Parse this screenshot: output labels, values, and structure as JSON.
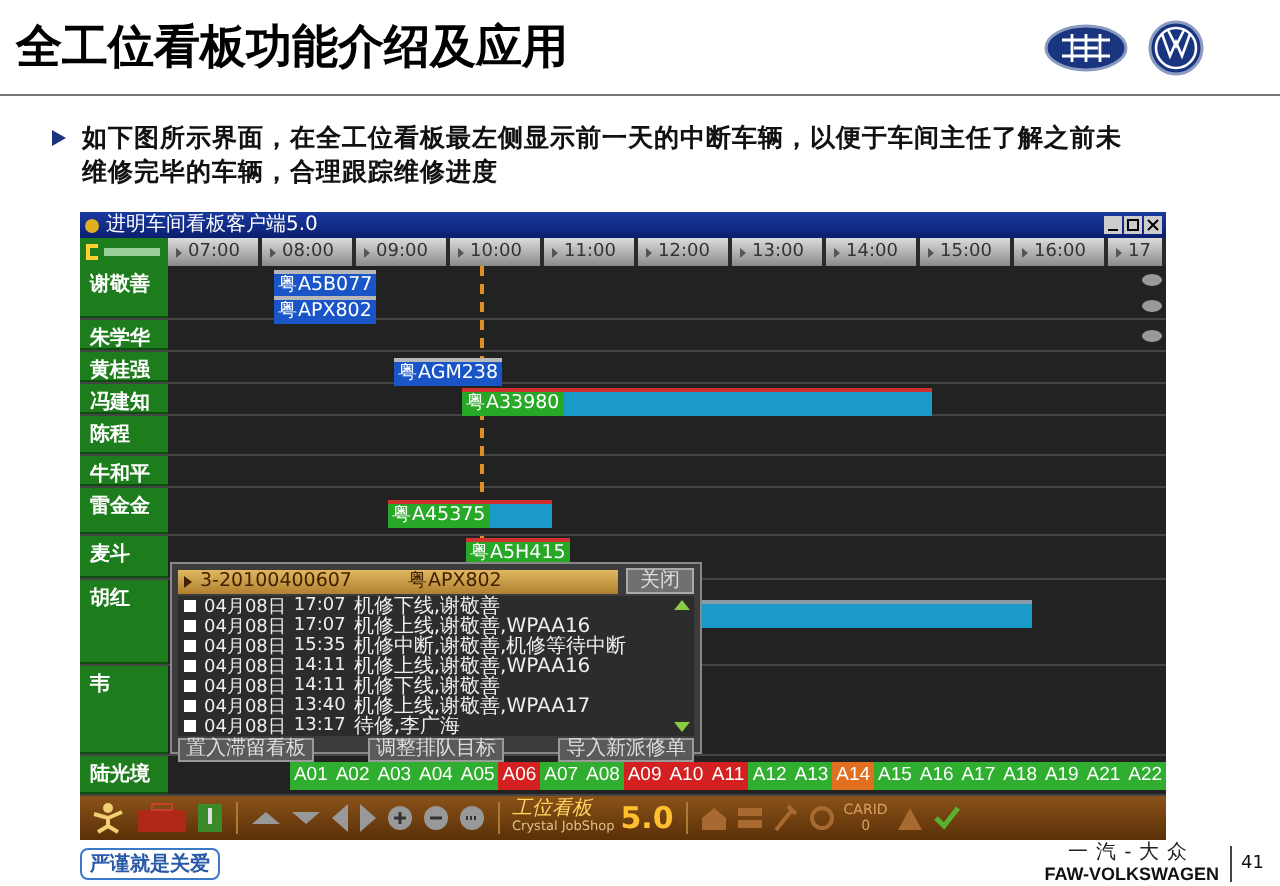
{
  "slide": {
    "title": "全工位看板功能介绍及应用",
    "bullet": "如下图所示界面，在全工位看板最左侧显示前一天的中断车辆，以便于车间主任了解之前未维修完毕的车辆，合理跟踪维修进度"
  },
  "app": {
    "title": "进明车间看板客户端5.0",
    "hours": [
      "07:00",
      "08:00",
      "09:00",
      "10:00",
      "11:00",
      "12:00",
      "13:00",
      "14:00",
      "15:00",
      "16:00",
      "17"
    ],
    "technicians": [
      {
        "name": "谢敬善",
        "bars": [
          {
            "plate": "粤A5B077",
            "kind": "queued"
          },
          {
            "plate": "粤APX802",
            "kind": "queued"
          }
        ]
      },
      {
        "name": "朱学华"
      },
      {
        "name": "黄桂强",
        "bars": [
          {
            "plate": "粤AGM238",
            "kind": "queued"
          }
        ]
      },
      {
        "name": "冯建知",
        "bars": [
          {
            "plate": "粤A33980",
            "kind": "active"
          }
        ]
      },
      {
        "name": "陈程"
      },
      {
        "name": "牛和平"
      },
      {
        "name": "雷金金",
        "bars": [
          {
            "plate": "粤A45375",
            "kind": "active"
          }
        ]
      },
      {
        "name": "麦斗",
        "bars": [
          {
            "plate": "粤A5H415",
            "kind": "active"
          }
        ]
      },
      {
        "name": "胡红",
        "bars": [
          {
            "kind": "running"
          }
        ]
      },
      {
        "name": "韦"
      },
      {
        "name": "陆光境"
      }
    ],
    "bays": [
      {
        "label": "A01",
        "color": "#2fae2f"
      },
      {
        "label": "A02",
        "color": "#2fae2f"
      },
      {
        "label": "A03",
        "color": "#2fae2f"
      },
      {
        "label": "A04",
        "color": "#2fae2f"
      },
      {
        "label": "A05",
        "color": "#2fae2f"
      },
      {
        "label": "A06",
        "color": "#d42020"
      },
      {
        "label": "A07",
        "color": "#2fae2f"
      },
      {
        "label": "A08",
        "color": "#2fae2f"
      },
      {
        "label": "A09",
        "color": "#d42020"
      },
      {
        "label": "A10",
        "color": "#d42020"
      },
      {
        "label": "A11",
        "color": "#d42020"
      },
      {
        "label": "A12",
        "color": "#2fae2f"
      },
      {
        "label": "A13",
        "color": "#2fae2f"
      },
      {
        "label": "A14",
        "color": "#e07020"
      },
      {
        "label": "A15",
        "color": "#2fae2f"
      },
      {
        "label": "A16",
        "color": "#2fae2f"
      },
      {
        "label": "A17",
        "color": "#2fae2f"
      },
      {
        "label": "A18",
        "color": "#2fae2f"
      },
      {
        "label": "A19",
        "color": "#2fae2f"
      },
      {
        "label": "A21",
        "color": "#2fae2f"
      },
      {
        "label": "A22",
        "color": "#2fae2f"
      }
    ],
    "toolbar": {
      "logo_title": "工位看板",
      "logo_subtitle": "Crystal JobShop",
      "version": "5.0",
      "car_id_label": "CARID",
      "car_id_value": "0"
    },
    "dialog": {
      "order": "3-20100400607",
      "plate": "粤APX802",
      "close": "关闭",
      "log": [
        {
          "date": "04月08日",
          "time": "17:07",
          "message": "机修下线,谢敬善",
          "checked": false
        },
        {
          "date": "04月08日",
          "time": "17:07",
          "message": "机修上线,谢敬善,WPAA16",
          "checked": false
        },
        {
          "date": "04月08日",
          "time": "15:35",
          "message": "机修中断,谢敬善,机修等待中断",
          "checked": false
        },
        {
          "date": "04月08日",
          "time": "14:11",
          "message": "机修上线,谢敬善,WPAA16",
          "checked": false
        },
        {
          "date": "04月08日",
          "time": "14:11",
          "message": "机修下线,谢敬善",
          "checked": false
        },
        {
          "date": "04月08日",
          "time": "13:40",
          "message": "机修上线,谢敬善,WPAA17",
          "checked": false
        },
        {
          "date": "04月08日",
          "time": "13:17",
          "message": "待修,李广海",
          "checked": false
        }
      ],
      "buttons": [
        "置入滞留看板",
        "调整排队目标",
        "导入新派修单"
      ]
    }
  },
  "footer": {
    "motto": "严谨就是关爱",
    "brand_cn": "一汽-大众",
    "brand_en": "FAW-VOLKSWAGEN",
    "page": "41"
  }
}
